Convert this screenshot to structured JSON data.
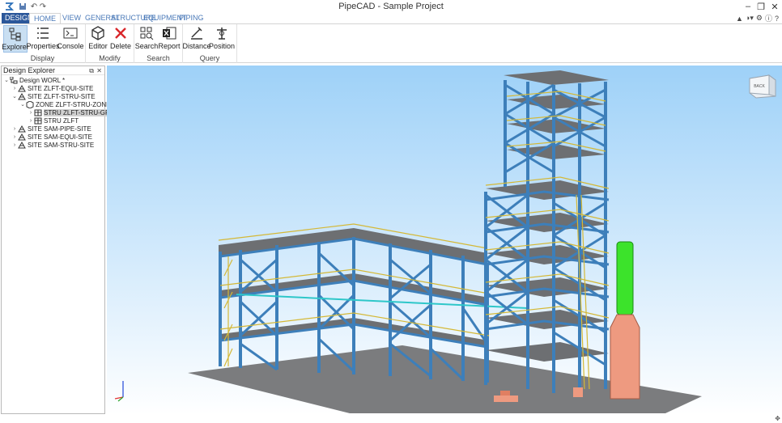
{
  "app": {
    "title": "PipeCAD - Sample Project"
  },
  "tabs": {
    "file": "DESIGN",
    "home": "HOME",
    "view": "VIEW",
    "general": "GENERAL",
    "structure": "STRUCTURE",
    "equipment": "EQUIPMENT",
    "piping": "PIPING"
  },
  "ribbon": {
    "display": {
      "label": "Display",
      "explorer": "Explorer",
      "properties": "Properties",
      "console": "Console"
    },
    "modify": {
      "label": "Modify",
      "editor": "Editor",
      "delete": "Delete"
    },
    "search": {
      "label": "Search",
      "search": "Search",
      "report": "Report"
    },
    "query": {
      "label": "Query",
      "distance": "Distance",
      "position": "Position"
    }
  },
  "explorer": {
    "title": "Design Explorer",
    "items": [
      {
        "label": "Design WORL *"
      },
      {
        "label": "SITE ZLFT-EQUI-SITE"
      },
      {
        "label": "SITE ZLFT-STRU-SITE"
      },
      {
        "label": "ZONE ZLFT-STRU-ZONE"
      },
      {
        "label": "STRU ZLFT-STRU-GRID"
      },
      {
        "label": "STRU ZLFT"
      },
      {
        "label": "SITE SAM-PIPE-SITE"
      },
      {
        "label": "SITE SAM-EQUI-SITE"
      },
      {
        "label": "SITE SAM-STRU-SITE"
      }
    ]
  },
  "viewcube": {
    "face": "BACK"
  },
  "colors": {
    "steel": "#3d7fba",
    "deck": "#6d6f72",
    "ground": "#7b7c7e",
    "vessel_top": "#3ce32b",
    "vessel_bottom": "#ee9a80",
    "accent": "#2b579a"
  }
}
